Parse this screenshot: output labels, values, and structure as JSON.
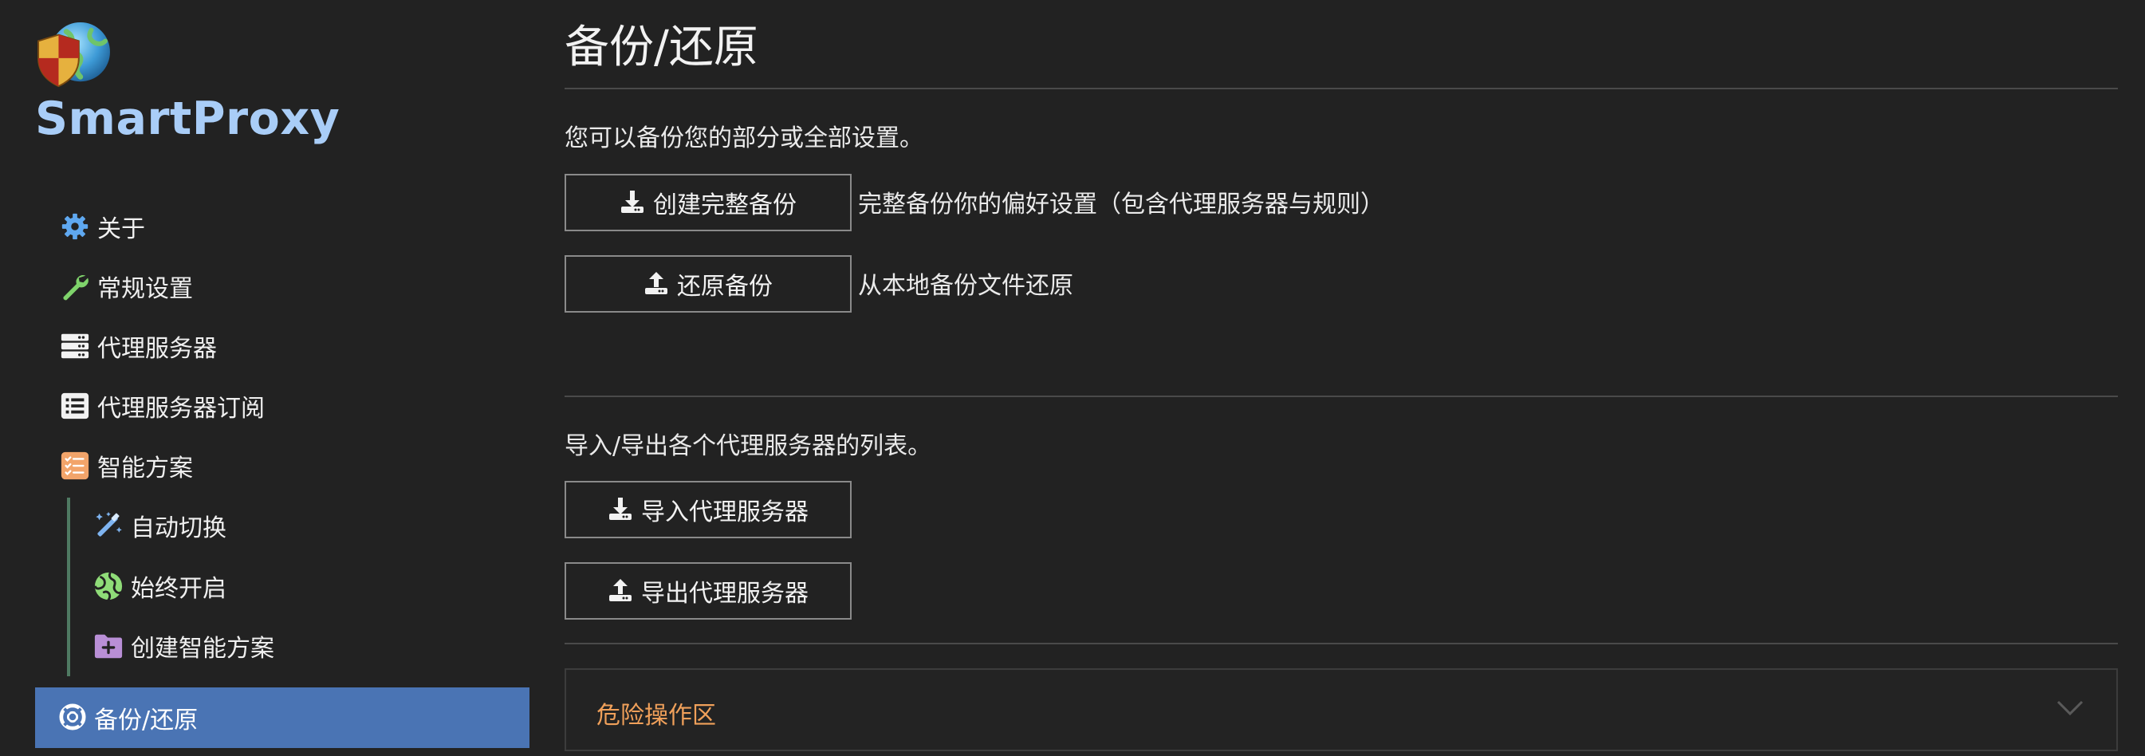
{
  "app": {
    "name": "SmartProxy"
  },
  "sidebar": {
    "items": [
      {
        "label": "关于",
        "icon": "gear-icon"
      },
      {
        "label": "常规设置",
        "icon": "wrench-icon"
      },
      {
        "label": "代理服务器",
        "icon": "server-icon"
      },
      {
        "label": "代理服务器订阅",
        "icon": "list-icon"
      },
      {
        "label": "智能方案",
        "icon": "checklist-icon"
      },
      {
        "label": "自动切换",
        "icon": "magic-wand-icon"
      },
      {
        "label": "始终开启",
        "icon": "globe-icon"
      },
      {
        "label": "创建智能方案",
        "icon": "folder-plus-icon"
      }
    ],
    "active": {
      "label": "备份/还原",
      "icon": "lifebuoy-icon"
    }
  },
  "main": {
    "title": "备份/还原",
    "backup": {
      "description": "您可以备份您的部分或全部设置。",
      "create_button": "创建完整备份",
      "create_note": "完整备份你的偏好设置（包含代理服务器与规则）",
      "restore_button": "还原备份",
      "restore_note": "从本地备份文件还原"
    },
    "proxies": {
      "description": "导入/导出各个代理服务器的列表。",
      "import_button": "导入代理服务器",
      "export_button": "导出代理服务器"
    },
    "danger_zone": {
      "label": "危险操作区"
    }
  },
  "colors": {
    "background": "#222222",
    "brand": "#a9cdf7",
    "active_nav": "#4a74b4",
    "danger": "#f0a05a"
  }
}
